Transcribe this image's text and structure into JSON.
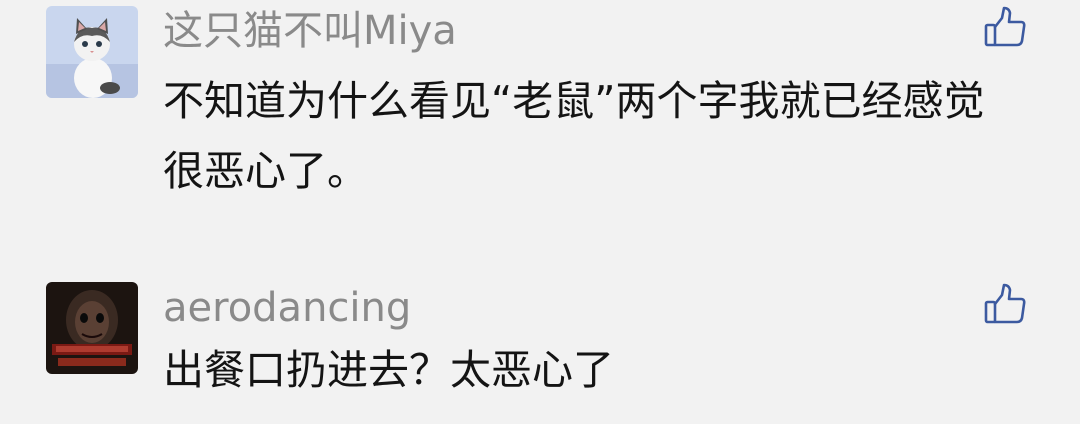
{
  "comments": [
    {
      "username": "这只猫不叫Miya",
      "text": "不知道为什么看见“老鼠”两个字我就已经感觉很恶心了。",
      "avatar_icon": "cat-avatar",
      "like_icon": "thumbs-up-icon"
    },
    {
      "username": "aerodancing",
      "text": "出餐口扔进去？太恶心了",
      "avatar_icon": "horror-poster-avatar",
      "like_icon": "thumbs-up-icon"
    }
  ],
  "colors": {
    "background": "#f2f2f2",
    "username": "#8a8a8a",
    "text": "#141414",
    "like_icon": "#3c5aa0"
  }
}
